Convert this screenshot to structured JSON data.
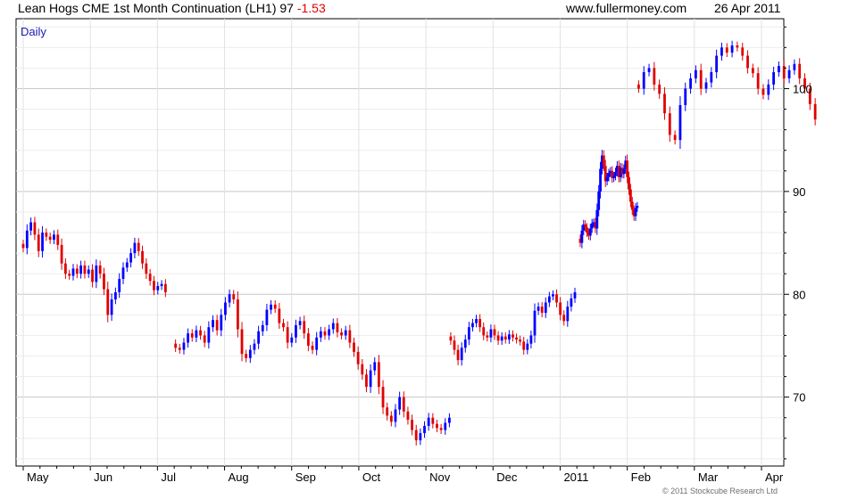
{
  "header": {
    "title": "Lean Hogs CME 1st Month Continuation (LH1) 97",
    "change": "-1.53",
    "site": "www.fullermoney.com",
    "date": "26 Apr 2011"
  },
  "period_label": "Daily",
  "copyright": "© 2011 Stockcube Research Ltd",
  "colors": {
    "up": "#0000ff",
    "down": "#e00000",
    "grid": "#d3d3d3",
    "axis": "#000000"
  },
  "chart_data": {
    "type": "candlestick",
    "title": "Lean Hogs CME 1st Month Continuation (LH1) 97",
    "x_labels": [
      "May",
      "Jun",
      "Jul",
      "Aug",
      "Sep",
      "Oct",
      "Nov",
      "Dec",
      "2011",
      "Feb",
      "Mar",
      "Apr"
    ],
    "y_ticks": [
      70,
      80,
      90,
      100
    ],
    "ylim": [
      63.3,
      106.8
    ],
    "grid": true,
    "series": [
      {
        "segment": "May-Jul 2010",
        "closes": [
          84.5,
          86.2,
          87.0,
          85.8,
          84.2,
          86.0,
          85.6,
          85.3,
          85.8,
          84.8,
          83.0,
          82.0,
          81.8,
          82.5,
          82.0,
          82.8,
          82.0,
          82.4,
          81.2,
          82.8,
          82.0,
          80.5,
          78.0,
          79.5,
          80.2,
          81.5,
          82.6,
          83.1,
          84.0,
          85.0,
          84.2,
          83.0,
          82.0,
          81.3,
          80.4,
          80.8,
          81.0,
          80.2
        ]
      },
      {
        "segment": "Jul-Nov 2010",
        "closes": [
          74.8,
          74.6,
          75.3,
          76.2,
          75.8,
          76.5,
          76.0,
          75.3,
          76.8,
          77.5,
          76.5,
          78.0,
          79.2,
          80.0,
          79.5,
          76.6,
          74.2,
          73.8,
          74.6,
          75.2,
          76.4,
          77.0,
          78.5,
          79.0,
          78.6,
          77.2,
          76.8,
          75.3,
          75.8,
          77.0,
          77.4,
          76.2,
          75.0,
          74.6,
          75.8,
          76.4,
          76.0,
          76.6,
          77.2,
          76.3,
          76.0,
          76.5,
          75.3,
          74.4,
          73.2,
          72.2,
          71.0,
          72.6,
          73.4,
          71.0,
          69.0,
          68.2,
          67.6,
          68.8,
          70.0,
          68.6,
          67.8,
          66.8,
          65.8,
          66.5,
          67.2,
          68.0,
          67.4,
          67.0,
          66.8,
          67.5,
          68.0
        ]
      },
      {
        "segment": "Nov 2010-Jan 2011",
        "closes": [
          75.5,
          74.6,
          73.6,
          74.8,
          75.6,
          76.8,
          77.2,
          77.6,
          76.8,
          76.0,
          75.8,
          76.6,
          76.0,
          75.5,
          75.9,
          75.6,
          76.1,
          75.8,
          75.6,
          75.4,
          74.6,
          75.2,
          76.0,
          78.4,
          78.8,
          78.2,
          79.2,
          79.8,
          80.0,
          79.2,
          78.0,
          77.4,
          78.8,
          79.6,
          80.2
        ]
      },
      {
        "segment": "Jan-Mar 2011",
        "closes": [
          85.0,
          86.2,
          86.8,
          86.5,
          86.0,
          85.7,
          86.4,
          86.9,
          87.0,
          86.4,
          88.2,
          90.0,
          92.2,
          93.5,
          92.5,
          91.0,
          91.4,
          91.8,
          92.0,
          91.3,
          91.5,
          91.9,
          92.5,
          91.4,
          92.3,
          91.7,
          92.2,
          93.0,
          91.4,
          90.2,
          89.0,
          88.2,
          87.6,
          88.4,
          88.6
        ]
      },
      {
        "segment": "Mar-Apr 2011",
        "closes": [
          100.0,
          101.6,
          102.0,
          100.4,
          99.5,
          97.6,
          95.5,
          95.0,
          98.4,
          100.0,
          101.0,
          101.8,
          100.0,
          100.6,
          101.6,
          103.2,
          104.0,
          103.5,
          104.2,
          104.0,
          103.2,
          102.0,
          101.5,
          100.0,
          99.4,
          100.4,
          101.6,
          102.2,
          101.0,
          101.8,
          102.4,
          101.0,
          100.0,
          98.5,
          97.0
        ]
      }
    ]
  }
}
